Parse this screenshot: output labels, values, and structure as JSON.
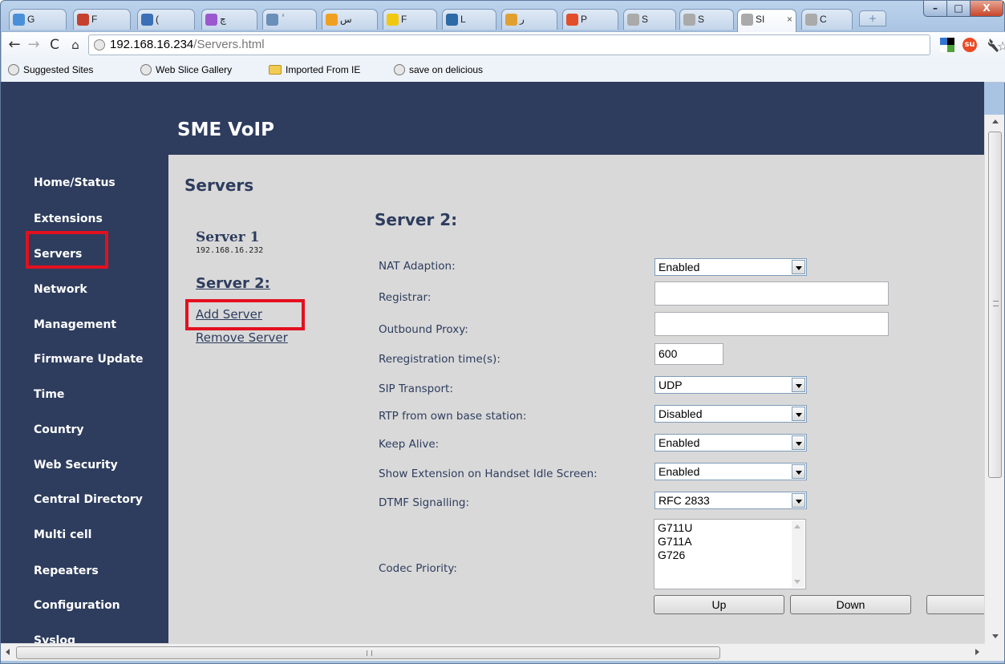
{
  "browser": {
    "tabs": [
      {
        "label": "G",
        "icon_color": "#4a90d9"
      },
      {
        "label": "F",
        "icon_color": "#c5412e"
      },
      {
        "label": "(",
        "icon_color": "#3b6fb6"
      },
      {
        "label": "چ",
        "icon_color": "#9b59d0"
      },
      {
        "label": "ٰ",
        "icon_color": "#6a8fb8"
      },
      {
        "label": "س",
        "icon_color": "#f0a020"
      },
      {
        "label": "F",
        "icon_color": "#f2c80f"
      },
      {
        "label": "L",
        "icon_color": "#2d6aa8"
      },
      {
        "label": "ر",
        "icon_color": "#e0a030"
      },
      {
        "label": "P",
        "icon_color": "#e24e2a"
      },
      {
        "label": "S",
        "icon_color": "#aaaaaa"
      },
      {
        "label": "S",
        "icon_color": "#aaaaaa"
      },
      {
        "label": "SI",
        "icon_color": "#aaaaaa"
      },
      {
        "label": "C",
        "icon_color": "#aaaaaa"
      }
    ],
    "active_tab_index": 12,
    "close_glyph": "×",
    "new_tab_glyph": "+",
    "url_host": "192.168.16.234",
    "url_path": "/Servers.html",
    "back_glyph": "←",
    "forward_glyph": "→",
    "reload_glyph": "C",
    "home_glyph": "⌂",
    "star_glyph": "☆",
    "stumble_glyph": "su",
    "bug_glyph": "✵",
    "window_min": "–",
    "window_max": "□",
    "window_close": "X"
  },
  "bookmarks": [
    {
      "label": "Suggested Sites",
      "type": "site"
    },
    {
      "label": "Web Slice Gallery",
      "type": "site"
    },
    {
      "label": "Imported From IE",
      "type": "folder"
    },
    {
      "label": "save on delicious",
      "type": "site"
    }
  ],
  "site": {
    "title": "SME VoIP"
  },
  "sidebar": {
    "items": [
      {
        "label": "Home/Status",
        "name": "home-status"
      },
      {
        "label": "Extensions",
        "name": "extensions"
      },
      {
        "label": "Servers",
        "name": "servers"
      },
      {
        "label": "Network",
        "name": "network"
      },
      {
        "label": "Management",
        "name": "management"
      },
      {
        "label": "Firmware Update",
        "name": "firmware-update"
      },
      {
        "label": "Time",
        "name": "time"
      },
      {
        "label": "Country",
        "name": "country"
      },
      {
        "label": "Web Security",
        "name": "web-security"
      },
      {
        "label": "Central Directory",
        "name": "central-directory"
      },
      {
        "label": "Multi cell",
        "name": "multi-cell"
      },
      {
        "label": "Repeaters",
        "name": "repeaters"
      },
      {
        "label": "Configuration",
        "name": "configuration"
      },
      {
        "label": "Syslog",
        "name": "syslog"
      }
    ],
    "selected": "Servers"
  },
  "servers_panel": {
    "page_title": "Servers",
    "server1_title": "Server 1",
    "server1_ip": "192.168.16.232",
    "server2_link": "Server 2:",
    "add_server": "Add Server",
    "remove_server": "Remove Server"
  },
  "form": {
    "title": "Server 2:",
    "nat_adaption": {
      "label": "NAT Adaption:",
      "value": "Enabled"
    },
    "registrar": {
      "label": "Registrar:",
      "value": ""
    },
    "outbound_proxy": {
      "label": "Outbound Proxy:",
      "value": ""
    },
    "reregistration_time": {
      "label": "Reregistration time(s):",
      "value": "600"
    },
    "sip_transport": {
      "label": "SIP Transport:",
      "value": "UDP"
    },
    "rtp_own_base": {
      "label": "RTP from own base station:",
      "value": "Disabled"
    },
    "keep_alive": {
      "label": "Keep Alive:",
      "value": "Enabled"
    },
    "show_extension": {
      "label": "Show Extension on Handset Idle Screen:",
      "value": "Enabled"
    },
    "dtmf_signalling": {
      "label": "DTMF Signalling:",
      "value": "RFC 2833"
    },
    "codec_priority": {
      "label": "Codec Priority:",
      "codecs": [
        "G711U",
        "G711A",
        "G726"
      ]
    },
    "up_button": "Up",
    "down_button": "Down"
  },
  "colors": {
    "banner": "#2e3d5e",
    "page_bg": "#d9d9d9",
    "highlight": "#e3101f",
    "heading": "#2e3d5e"
  }
}
